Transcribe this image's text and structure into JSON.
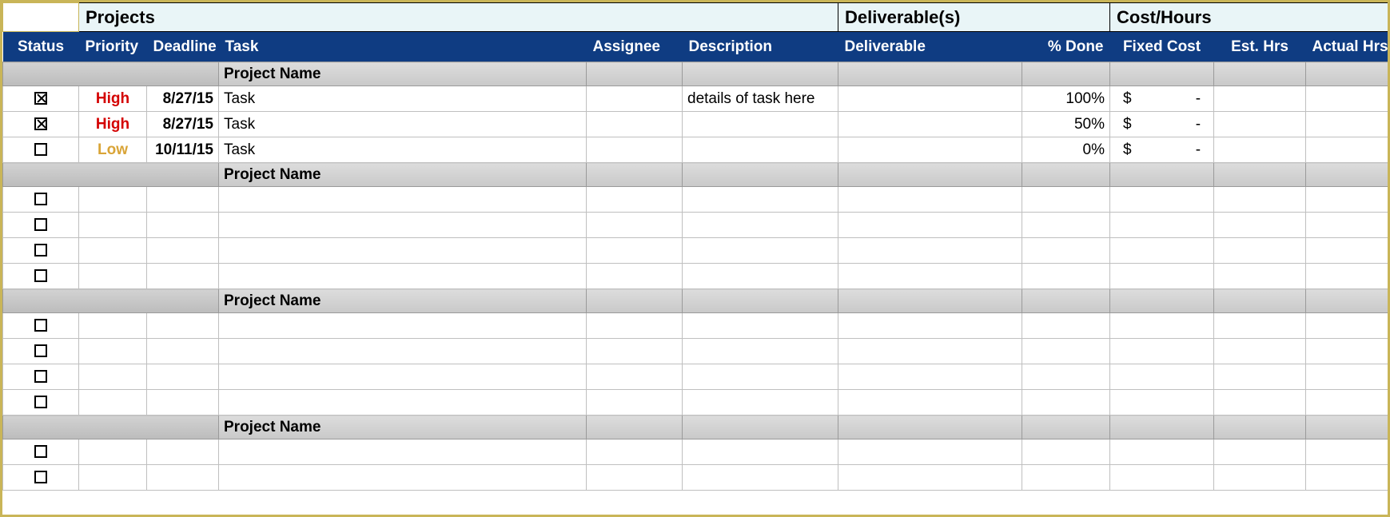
{
  "superheaders": {
    "projects": "Projects",
    "deliverables": "Deliverable(s)",
    "costhours": "Cost/Hours"
  },
  "columns": {
    "status": "Status",
    "priority": "Priority",
    "deadline": "Deadline",
    "task": "Task",
    "assignee": "Assignee",
    "description": "Description",
    "deliverable": "Deliverable",
    "pct_done": "% Done",
    "fixed_cost": "Fixed Cost",
    "est_hrs": "Est. Hrs",
    "actual_hrs": "Actual Hrs"
  },
  "groups": [
    {
      "title": "Project Name",
      "rows": [
        {
          "checked": true,
          "priority": "High",
          "priority_class": "prio-high",
          "deadline": "8/27/15",
          "task": "Task",
          "assignee": "",
          "description": "details of task here",
          "deliverable": "",
          "pct_done": "100%",
          "fixed_cost_sym": "$",
          "fixed_cost_val": "-",
          "est_hrs": "",
          "actual_hrs": ""
        },
        {
          "checked": true,
          "priority": "High",
          "priority_class": "prio-high",
          "deadline": "8/27/15",
          "task": "Task",
          "assignee": "",
          "description": "",
          "deliverable": "",
          "pct_done": "50%",
          "fixed_cost_sym": "$",
          "fixed_cost_val": "-",
          "est_hrs": "",
          "actual_hrs": ""
        },
        {
          "checked": false,
          "priority": "Low",
          "priority_class": "prio-low",
          "deadline": "10/11/15",
          "task": "Task",
          "assignee": "",
          "description": "",
          "deliverable": "",
          "pct_done": "0%",
          "fixed_cost_sym": "$",
          "fixed_cost_val": "-",
          "est_hrs": "",
          "actual_hrs": ""
        }
      ]
    },
    {
      "title": "Project Name",
      "rows": [
        {
          "checked": false,
          "priority": "",
          "priority_class": "",
          "deadline": "",
          "task": "",
          "assignee": "",
          "description": "",
          "deliverable": "",
          "pct_done": "",
          "fixed_cost_sym": "",
          "fixed_cost_val": "",
          "est_hrs": "",
          "actual_hrs": ""
        },
        {
          "checked": false,
          "priority": "",
          "priority_class": "",
          "deadline": "",
          "task": "",
          "assignee": "",
          "description": "",
          "deliverable": "",
          "pct_done": "",
          "fixed_cost_sym": "",
          "fixed_cost_val": "",
          "est_hrs": "",
          "actual_hrs": ""
        },
        {
          "checked": false,
          "priority": "",
          "priority_class": "",
          "deadline": "",
          "task": "",
          "assignee": "",
          "description": "",
          "deliverable": "",
          "pct_done": "",
          "fixed_cost_sym": "",
          "fixed_cost_val": "",
          "est_hrs": "",
          "actual_hrs": ""
        },
        {
          "checked": false,
          "priority": "",
          "priority_class": "",
          "deadline": "",
          "task": "",
          "assignee": "",
          "description": "",
          "deliverable": "",
          "pct_done": "",
          "fixed_cost_sym": "",
          "fixed_cost_val": "",
          "est_hrs": "",
          "actual_hrs": ""
        }
      ]
    },
    {
      "title": "Project Name",
      "rows": [
        {
          "checked": false,
          "priority": "",
          "priority_class": "",
          "deadline": "",
          "task": "",
          "assignee": "",
          "description": "",
          "deliverable": "",
          "pct_done": "",
          "fixed_cost_sym": "",
          "fixed_cost_val": "",
          "est_hrs": "",
          "actual_hrs": ""
        },
        {
          "checked": false,
          "priority": "",
          "priority_class": "",
          "deadline": "",
          "task": "",
          "assignee": "",
          "description": "",
          "deliverable": "",
          "pct_done": "",
          "fixed_cost_sym": "",
          "fixed_cost_val": "",
          "est_hrs": "",
          "actual_hrs": ""
        },
        {
          "checked": false,
          "priority": "",
          "priority_class": "",
          "deadline": "",
          "task": "",
          "assignee": "",
          "description": "",
          "deliverable": "",
          "pct_done": "",
          "fixed_cost_sym": "",
          "fixed_cost_val": "",
          "est_hrs": "",
          "actual_hrs": ""
        },
        {
          "checked": false,
          "priority": "",
          "priority_class": "",
          "deadline": "",
          "task": "",
          "assignee": "",
          "description": "",
          "deliverable": "",
          "pct_done": "",
          "fixed_cost_sym": "",
          "fixed_cost_val": "",
          "est_hrs": "",
          "actual_hrs": ""
        }
      ]
    },
    {
      "title": "Project Name",
      "rows": [
        {
          "checked": false,
          "priority": "",
          "priority_class": "",
          "deadline": "",
          "task": "",
          "assignee": "",
          "description": "",
          "deliverable": "",
          "pct_done": "",
          "fixed_cost_sym": "",
          "fixed_cost_val": "",
          "est_hrs": "",
          "actual_hrs": ""
        },
        {
          "checked": false,
          "priority": "",
          "priority_class": "",
          "deadline": "",
          "task": "",
          "assignee": "",
          "description": "",
          "deliverable": "",
          "pct_done": "",
          "fixed_cost_sym": "",
          "fixed_cost_val": "",
          "est_hrs": "",
          "actual_hrs": ""
        }
      ]
    }
  ]
}
